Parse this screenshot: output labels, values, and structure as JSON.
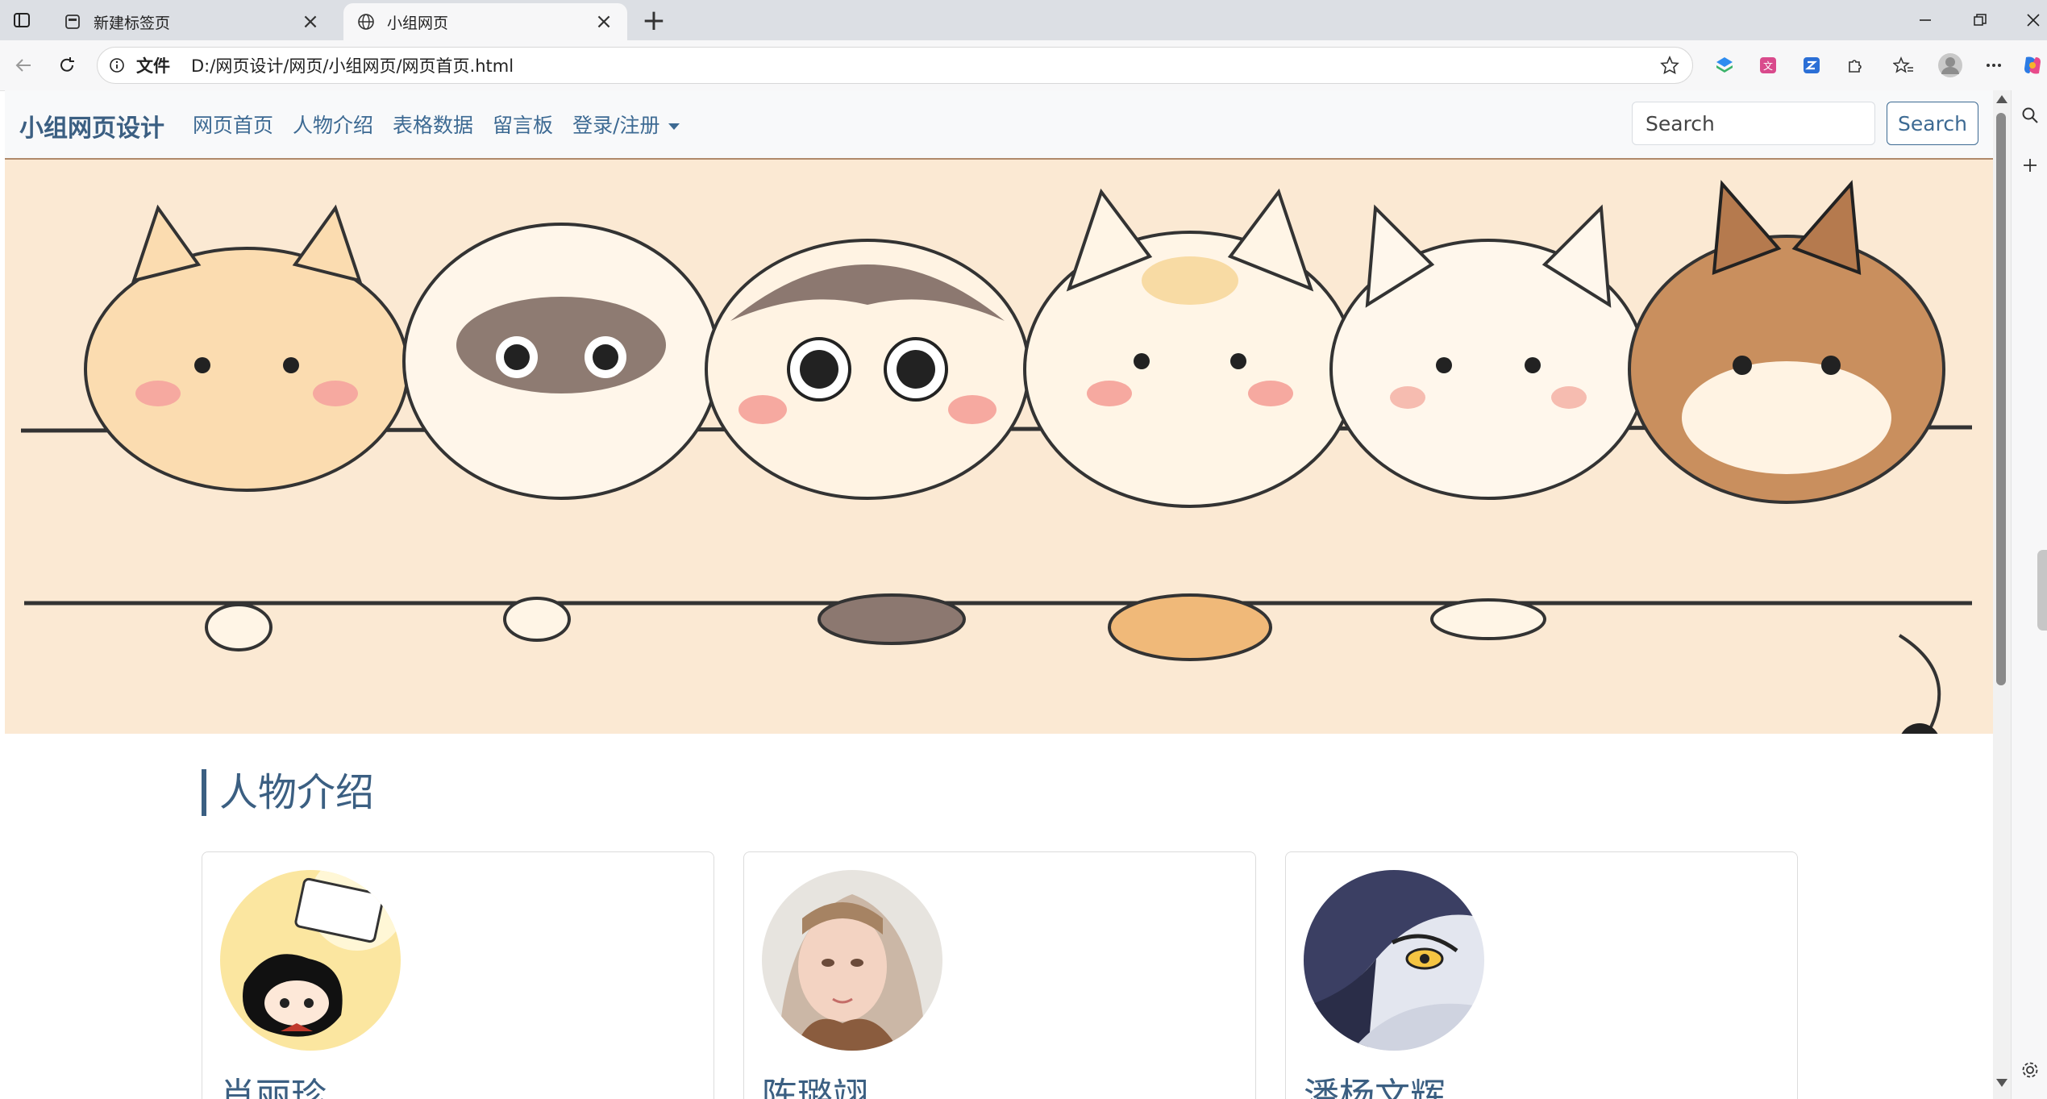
{
  "browser": {
    "tabs": [
      {
        "label": "新建标签页",
        "icon": "new-tab-page-icon"
      },
      {
        "label": "小组网页",
        "icon": "globe-icon",
        "active": true
      }
    ],
    "address": {
      "scheme_label": "文件",
      "url": "D:/网页设计/网页/小组网页/网页首页.html"
    }
  },
  "site": {
    "brand": "小组网页设计",
    "nav": [
      {
        "label": "网页首页"
      },
      {
        "label": "人物介绍"
      },
      {
        "label": "表格数据"
      },
      {
        "label": "留言板"
      },
      {
        "label": "登录/注册"
      }
    ],
    "search": {
      "placeholder": "Search",
      "button": "Search"
    },
    "banner_alt": "cartoon animals banner",
    "section_title": "人物介绍",
    "members": [
      {
        "name": "肖丽珍"
      },
      {
        "name": "陈璐翊"
      },
      {
        "name": "潘杨文辉"
      }
    ]
  },
  "colors": {
    "accent": "#3b5f82",
    "nav_bg": "#f8f9fa",
    "banner_bg": "#fbe9d3"
  }
}
